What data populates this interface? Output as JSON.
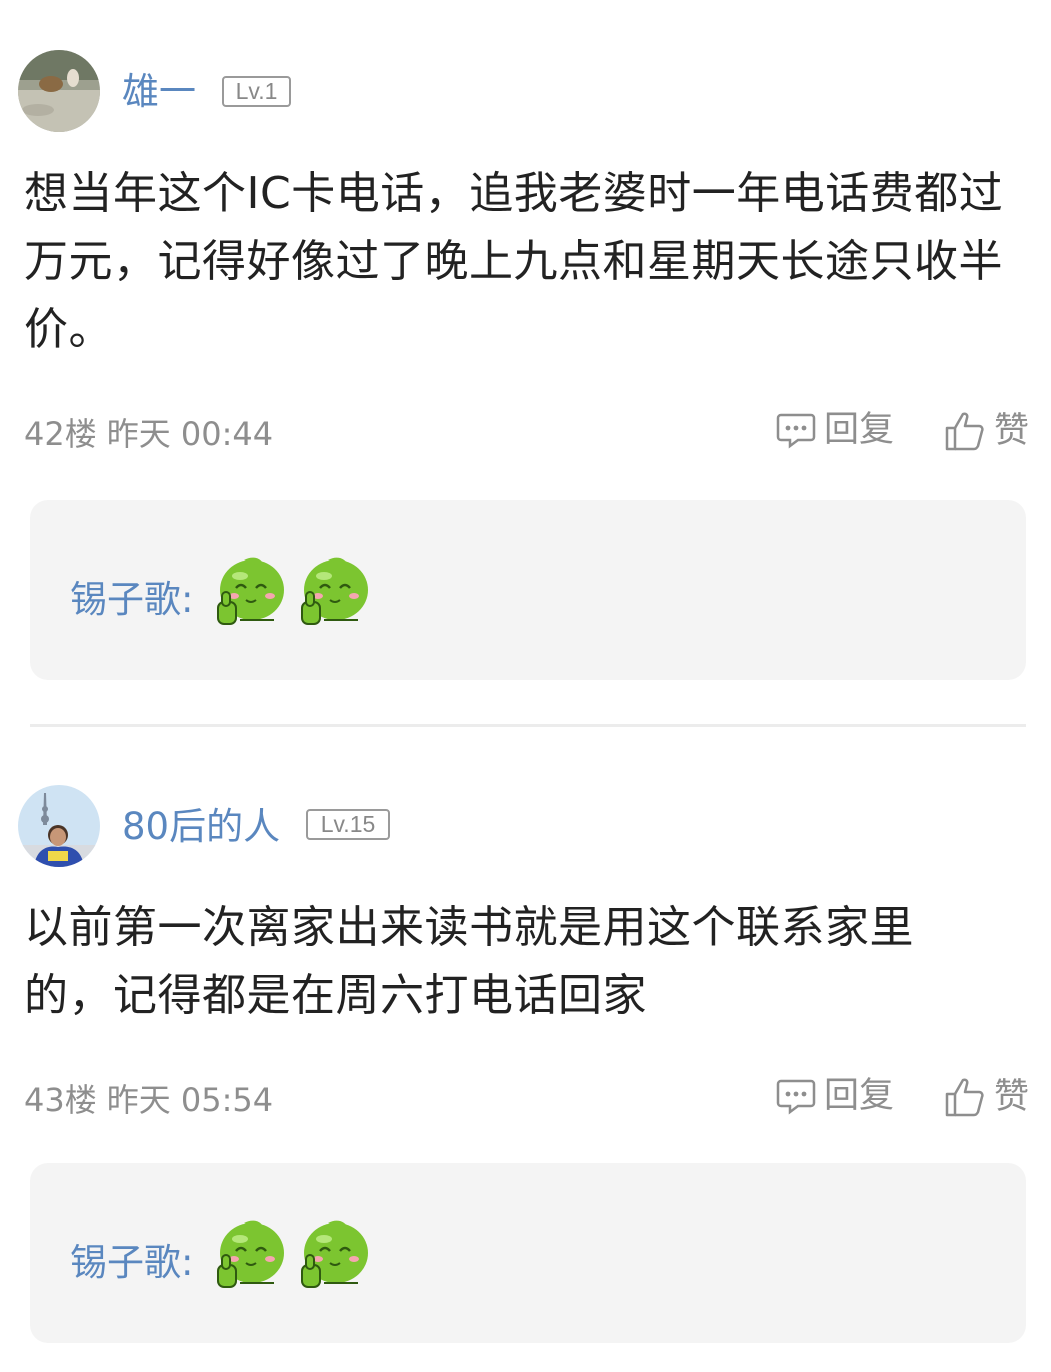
{
  "posts": [
    {
      "username": "雄一",
      "level": "Lv.1",
      "content": "想当年这个IC卡电话，追我老婆时一年电话费都过万元，记得好像过了晚上九点和星期天长途只收半价。",
      "floor": "42楼",
      "time": "昨天 00:44",
      "reply_label": "回复",
      "like_label": "赞",
      "sub_comment": {
        "author": "锡子歌:",
        "emojis": [
          "thumbs-up-green-emoji",
          "thumbs-up-green-emoji"
        ]
      }
    },
    {
      "username": "80后的人",
      "level": "Lv.15",
      "content": "以前第一次离家出来读书就是用这个联系家里的，记得都是在周六打电话回家",
      "floor": "43楼",
      "time": "昨天 05:54",
      "reply_label": "回复",
      "like_label": "赞",
      "sub_comment": {
        "author": "锡子歌:",
        "emojis": [
          "thumbs-up-green-emoji",
          "thumbs-up-green-emoji"
        ]
      }
    }
  ],
  "colors": {
    "username": "#5a87bf",
    "meta": "#8e8e8e",
    "content": "#222222",
    "sub_comment_bg": "#f4f4f4",
    "divider": "#ececec",
    "emoji_green": "#7cc530"
  }
}
